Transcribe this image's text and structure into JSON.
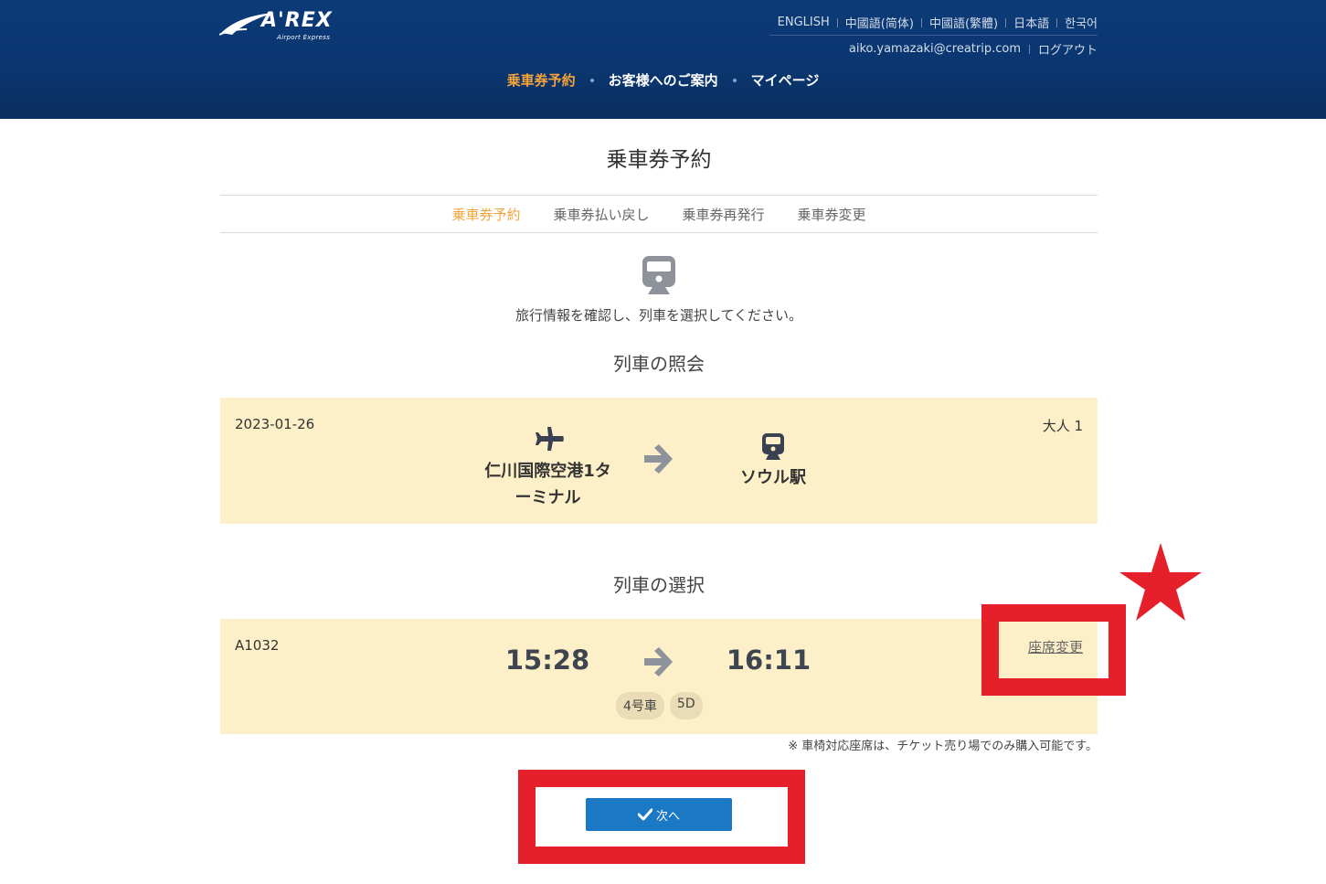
{
  "header": {
    "logo_text": "A'REX",
    "logo_sub": "Airport Express",
    "languages": [
      "ENGLISH",
      "中國語(简体)",
      "中國語(繁體)",
      "日本語",
      "한국어"
    ],
    "user_email": "aiko.yamazaki@creatrip.com",
    "logout": "ログアウト",
    "nav": [
      "乗車券予約",
      "お客様へのご案内",
      "マイページ"
    ]
  },
  "page": {
    "title": "乗車券予約",
    "tabs": [
      "乗車券予約",
      "乗車券払い戻し",
      "乗車券再発行",
      "乗車券変更"
    ],
    "instruction": "旅行情報を確認し、列車を選択してください。"
  },
  "inquiry": {
    "section_title": "列車の照会",
    "date": "2023-01-26",
    "from_station_line1": "仁川国際空港1タ",
    "from_station_line2": "ーミナル",
    "to_station": "ソウル駅",
    "passengers": "大人 1"
  },
  "selection": {
    "section_title": "列車の選択",
    "train_no": "A1032",
    "depart_time": "15:28",
    "arrive_time": "16:11",
    "car": "4号車",
    "seat": "5D",
    "seat_change": "座席変更",
    "note": "※ 車椅対応座席は、チケット売り場でのみ購入可能です。"
  },
  "actions": {
    "next_label": "次へ"
  },
  "colors": {
    "header_bg": "#0b3a75",
    "accent_orange": "#f3a33a",
    "panel_bg": "#fdf0c9",
    "button_blue": "#1a78c4",
    "annotation_red": "#e5202a"
  },
  "icons": {
    "hero": "train-icon",
    "from": "airplane-icon",
    "to": "train-icon",
    "direction": "arrow-right-icon",
    "annotation": "star-icon",
    "button": "check-icon"
  }
}
